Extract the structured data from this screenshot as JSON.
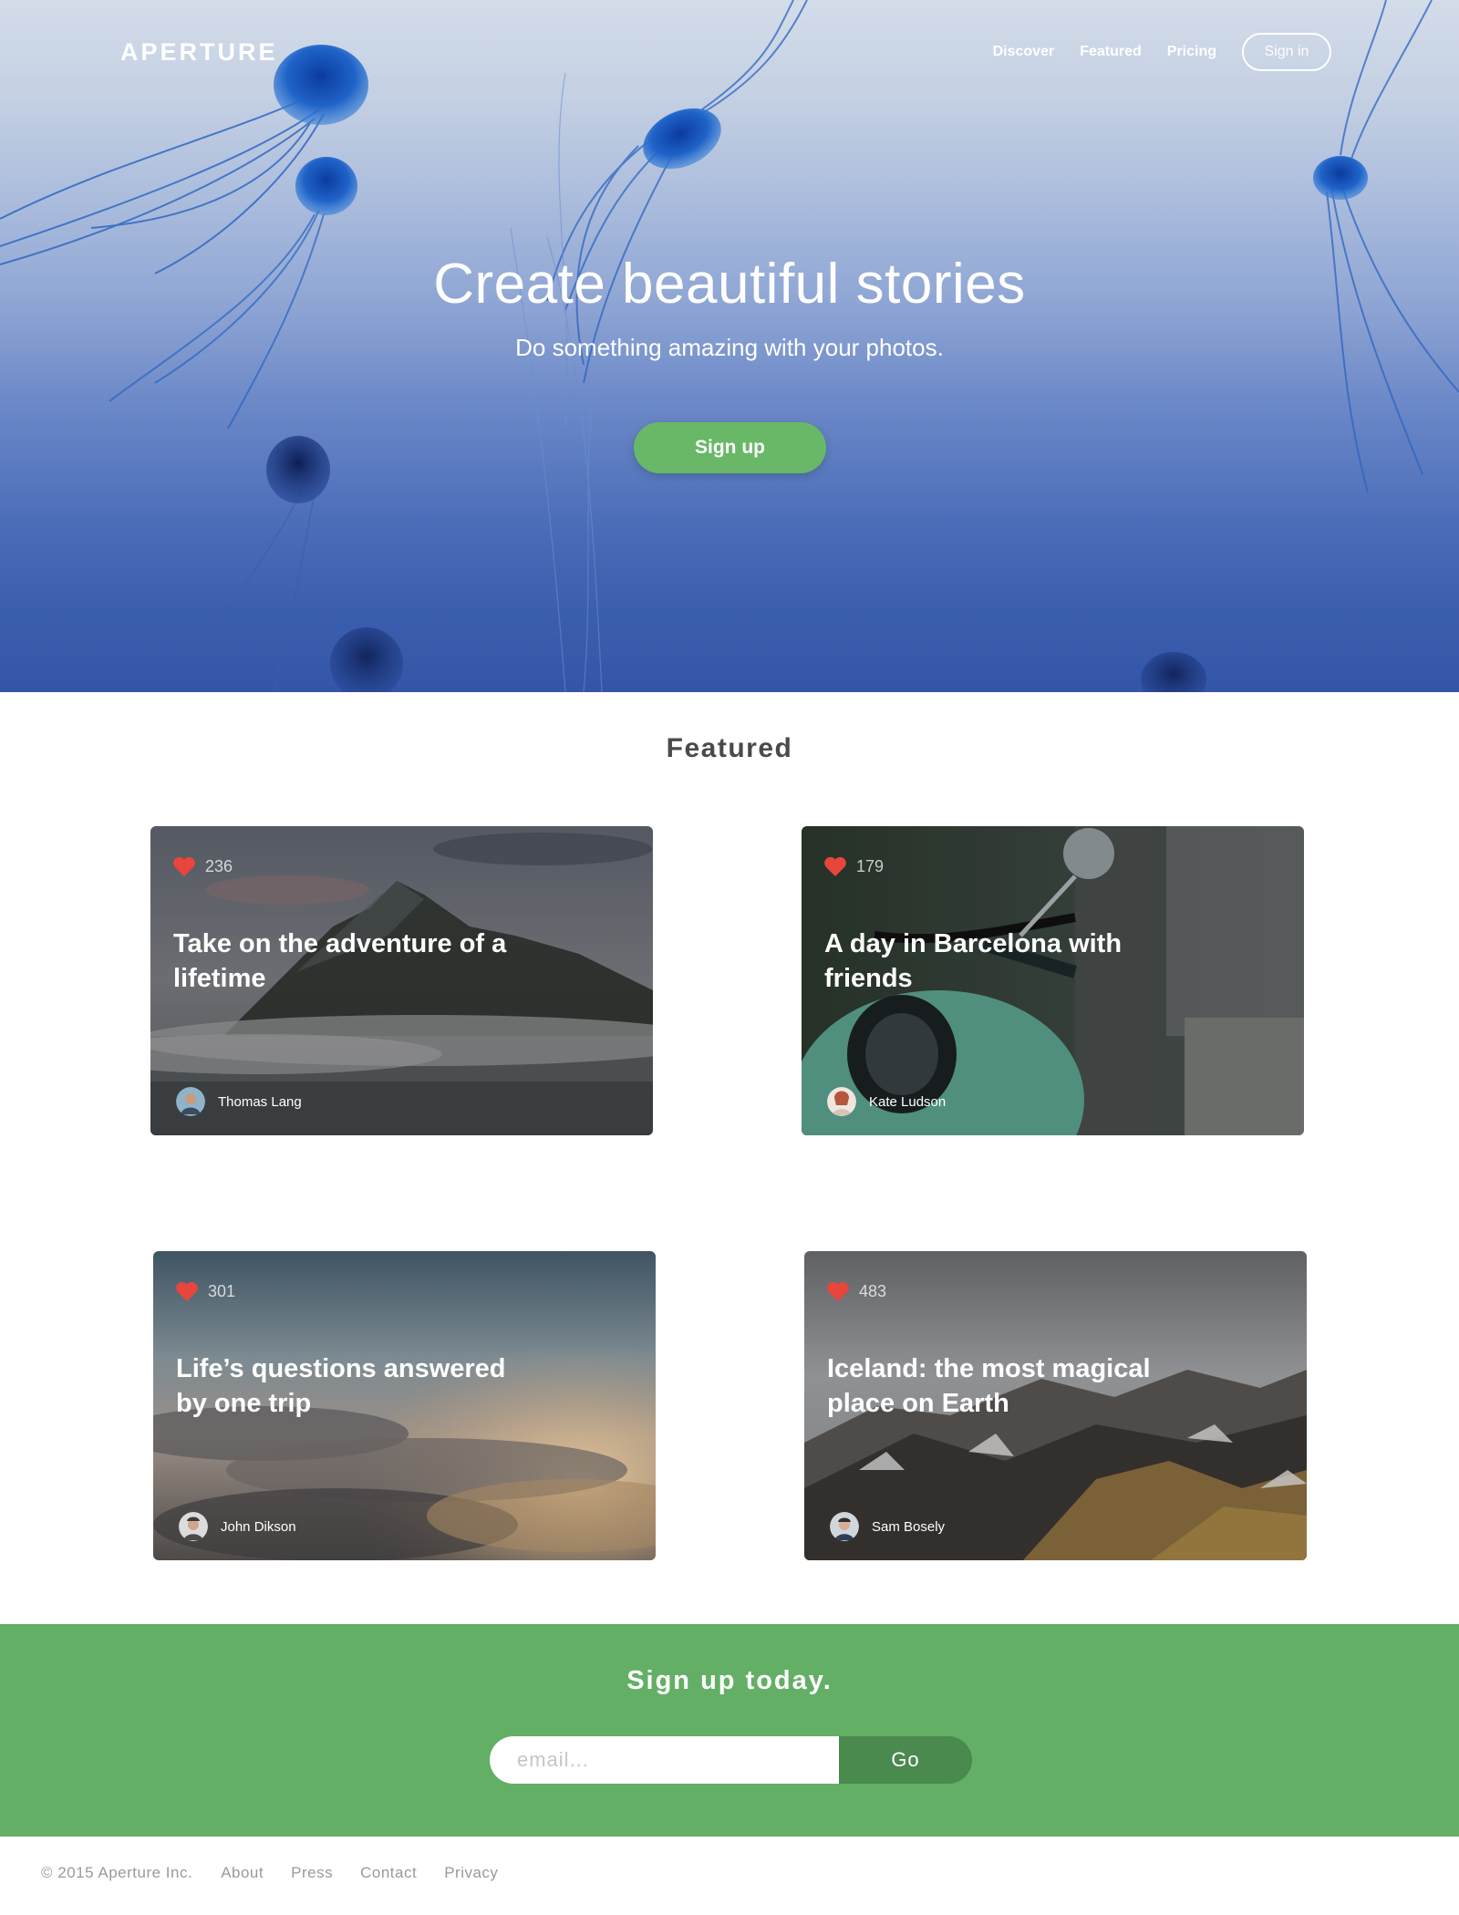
{
  "header": {
    "brand": "APERTURE",
    "nav": {
      "discover": "Discover",
      "featured": "Featured",
      "pricing": "Pricing",
      "sign_in": "Sign in"
    }
  },
  "hero": {
    "title": "Create beautiful stories",
    "subtitle": "Do something amazing with your photos.",
    "cta": "Sign up"
  },
  "featured": {
    "heading": "Featured",
    "cards": [
      {
        "likes": "236",
        "title": "Take on the adventure of a lifetime",
        "author": "Thomas Lang"
      },
      {
        "likes": "179",
        "title": "A day in Barcelona with friends",
        "author": "Kate Ludson"
      },
      {
        "likes": "301",
        "title": "Life’s questions answered by one trip",
        "author": "John Dikson"
      },
      {
        "likes": "483",
        "title": "Iceland: the most magical place on Earth",
        "author": "Sam Bosely"
      }
    ]
  },
  "signup": {
    "heading": "Sign up today.",
    "email_placeholder": "email...",
    "button": "Go"
  },
  "footer": {
    "copyright": "© 2015 Aperture Inc.",
    "links": [
      "About",
      "Press",
      "Contact",
      "Privacy"
    ]
  },
  "colors": {
    "accent_green": "#68b868",
    "band_green": "#63af66",
    "go_green": "#4a8a4e",
    "heart_red": "#e8453c"
  }
}
